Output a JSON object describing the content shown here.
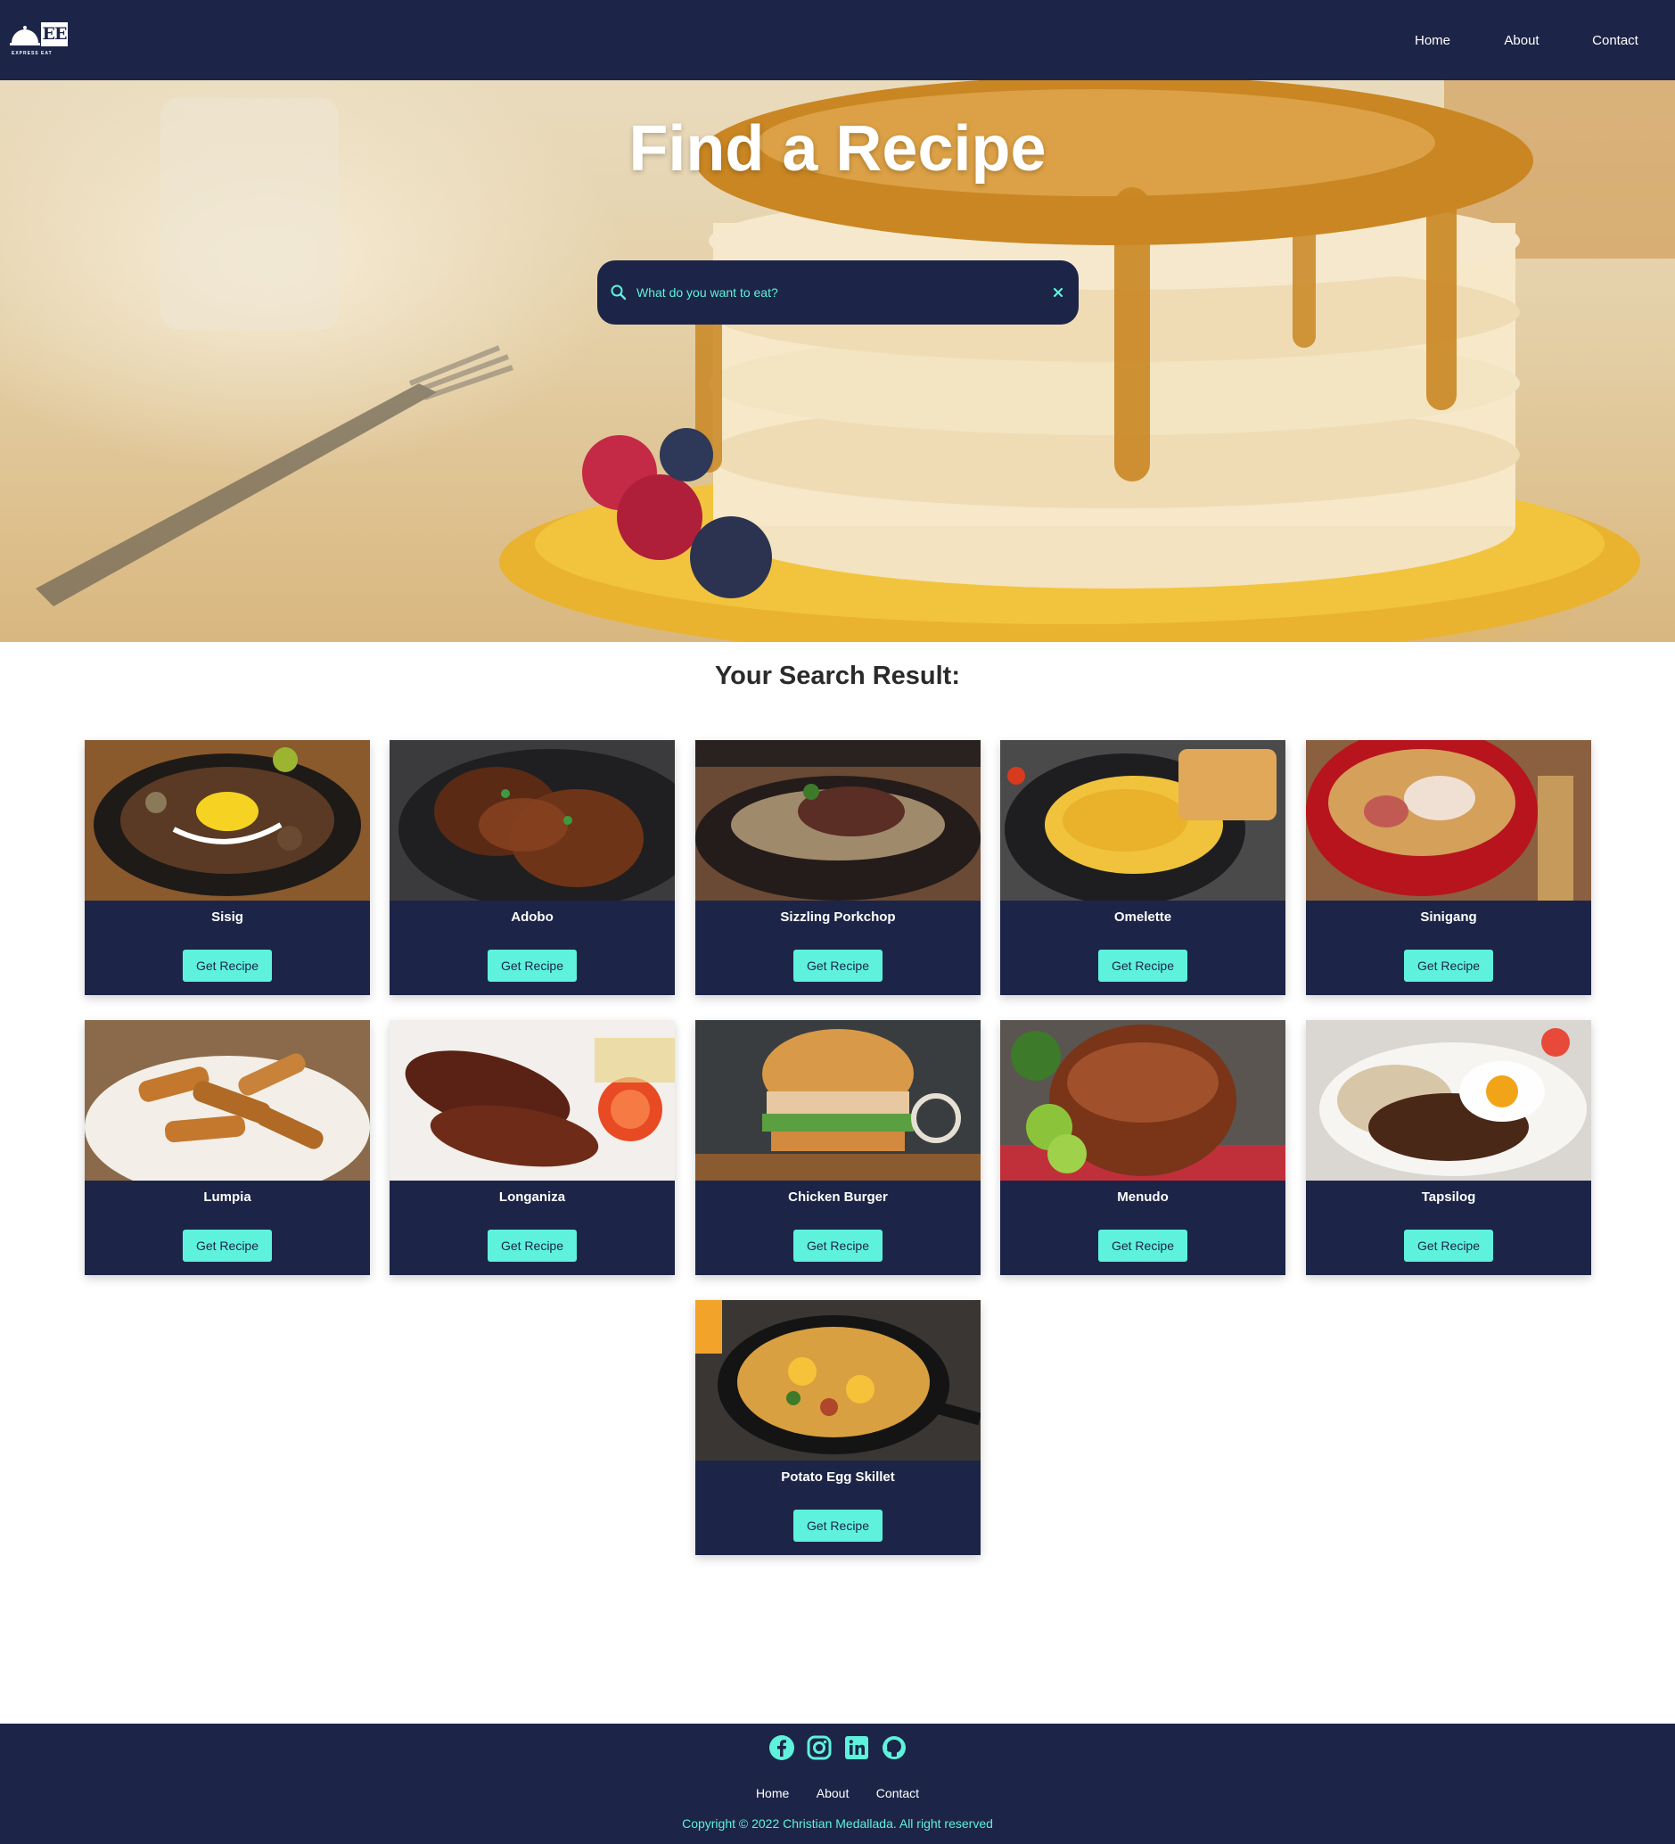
{
  "nav": {
    "logo_text": "EE",
    "logo_sub": "EXPRESS EAT",
    "links": [
      "Home",
      "About",
      "Contact"
    ]
  },
  "hero": {
    "title": "Find a Recipe",
    "search_placeholder": "What do you want to eat?"
  },
  "results": {
    "title": "Your Search Result:",
    "button_label": "Get Recipe",
    "cards": [
      {
        "name": "Sisig"
      },
      {
        "name": "Adobo"
      },
      {
        "name": "Sizzling Porkchop"
      },
      {
        "name": "Omelette"
      },
      {
        "name": "Sinigang"
      },
      {
        "name": "Lumpia"
      },
      {
        "name": "Longaniza"
      },
      {
        "name": "Chicken Burger"
      },
      {
        "name": "Menudo"
      },
      {
        "name": "Tapsilog"
      },
      {
        "name": "Potato Egg Skillet"
      }
    ]
  },
  "footer": {
    "social_icons": [
      "facebook-icon",
      "instagram-icon",
      "linkedin-icon",
      "github-icon"
    ],
    "links": [
      "Home",
      "About",
      "Contact"
    ],
    "copyright": "Copyright © 2022 Christian Medallada. All right reserved"
  },
  "colors": {
    "navy": "#1c2547",
    "accent": "#5ef2dc"
  }
}
